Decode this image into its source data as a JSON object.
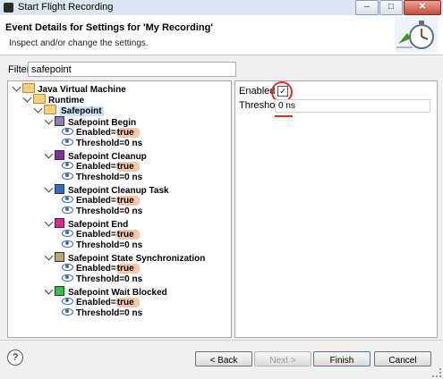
{
  "window": {
    "title": "Start Flight Recording"
  },
  "header": {
    "title": "Event Details for Settings for 'My Recording'",
    "subtitle": "Inspect and/or change the settings."
  },
  "filter": {
    "label": "Filter:",
    "value": "safepoint"
  },
  "tree": {
    "jvm": "Java Virtual Machine",
    "runtime": "Runtime",
    "safepoint": "Safepoint",
    "events": [
      {
        "name": "Safepoint Begin",
        "color": "#8c7fb7",
        "enabled_label": "Enabled=",
        "enabled_value": "true",
        "threshold": "Threshold=0 ns"
      },
      {
        "name": "Safepoint Cleanup",
        "color": "#7b2fa8",
        "enabled_label": "Enabled=",
        "enabled_value": "true",
        "threshold": "Threshold=0 ns"
      },
      {
        "name": "Safepoint Cleanup Task",
        "color": "#2f6cc7",
        "enabled_label": "Enabled=",
        "enabled_value": "true",
        "threshold": "Threshold=0 ns"
      },
      {
        "name": "Safepoint End",
        "color": "#e0229a",
        "enabled_label": "Enabled=",
        "enabled_value": "true",
        "threshold": "Threshold=0 ns"
      },
      {
        "name": "Safepoint State Synchronization",
        "color": "#b9a86a",
        "enabled_label": "Enabled=",
        "enabled_value": "true",
        "threshold": "Threshold=0 ns"
      },
      {
        "name": "Safepoint Wait Blocked",
        "color": "#2fbf4a",
        "enabled_label": "Enabled=",
        "enabled_value": "true",
        "threshold": "Threshold=0 ns"
      }
    ]
  },
  "properties": {
    "enabled_label": "Enabled",
    "enabled_check": "✓",
    "threshold_label": "Threshold",
    "threshold_value": "0 ns"
  },
  "footer": {
    "help": "?",
    "back": "< Back",
    "next": "Next >",
    "finish": "Finish",
    "cancel": "Cancel"
  }
}
